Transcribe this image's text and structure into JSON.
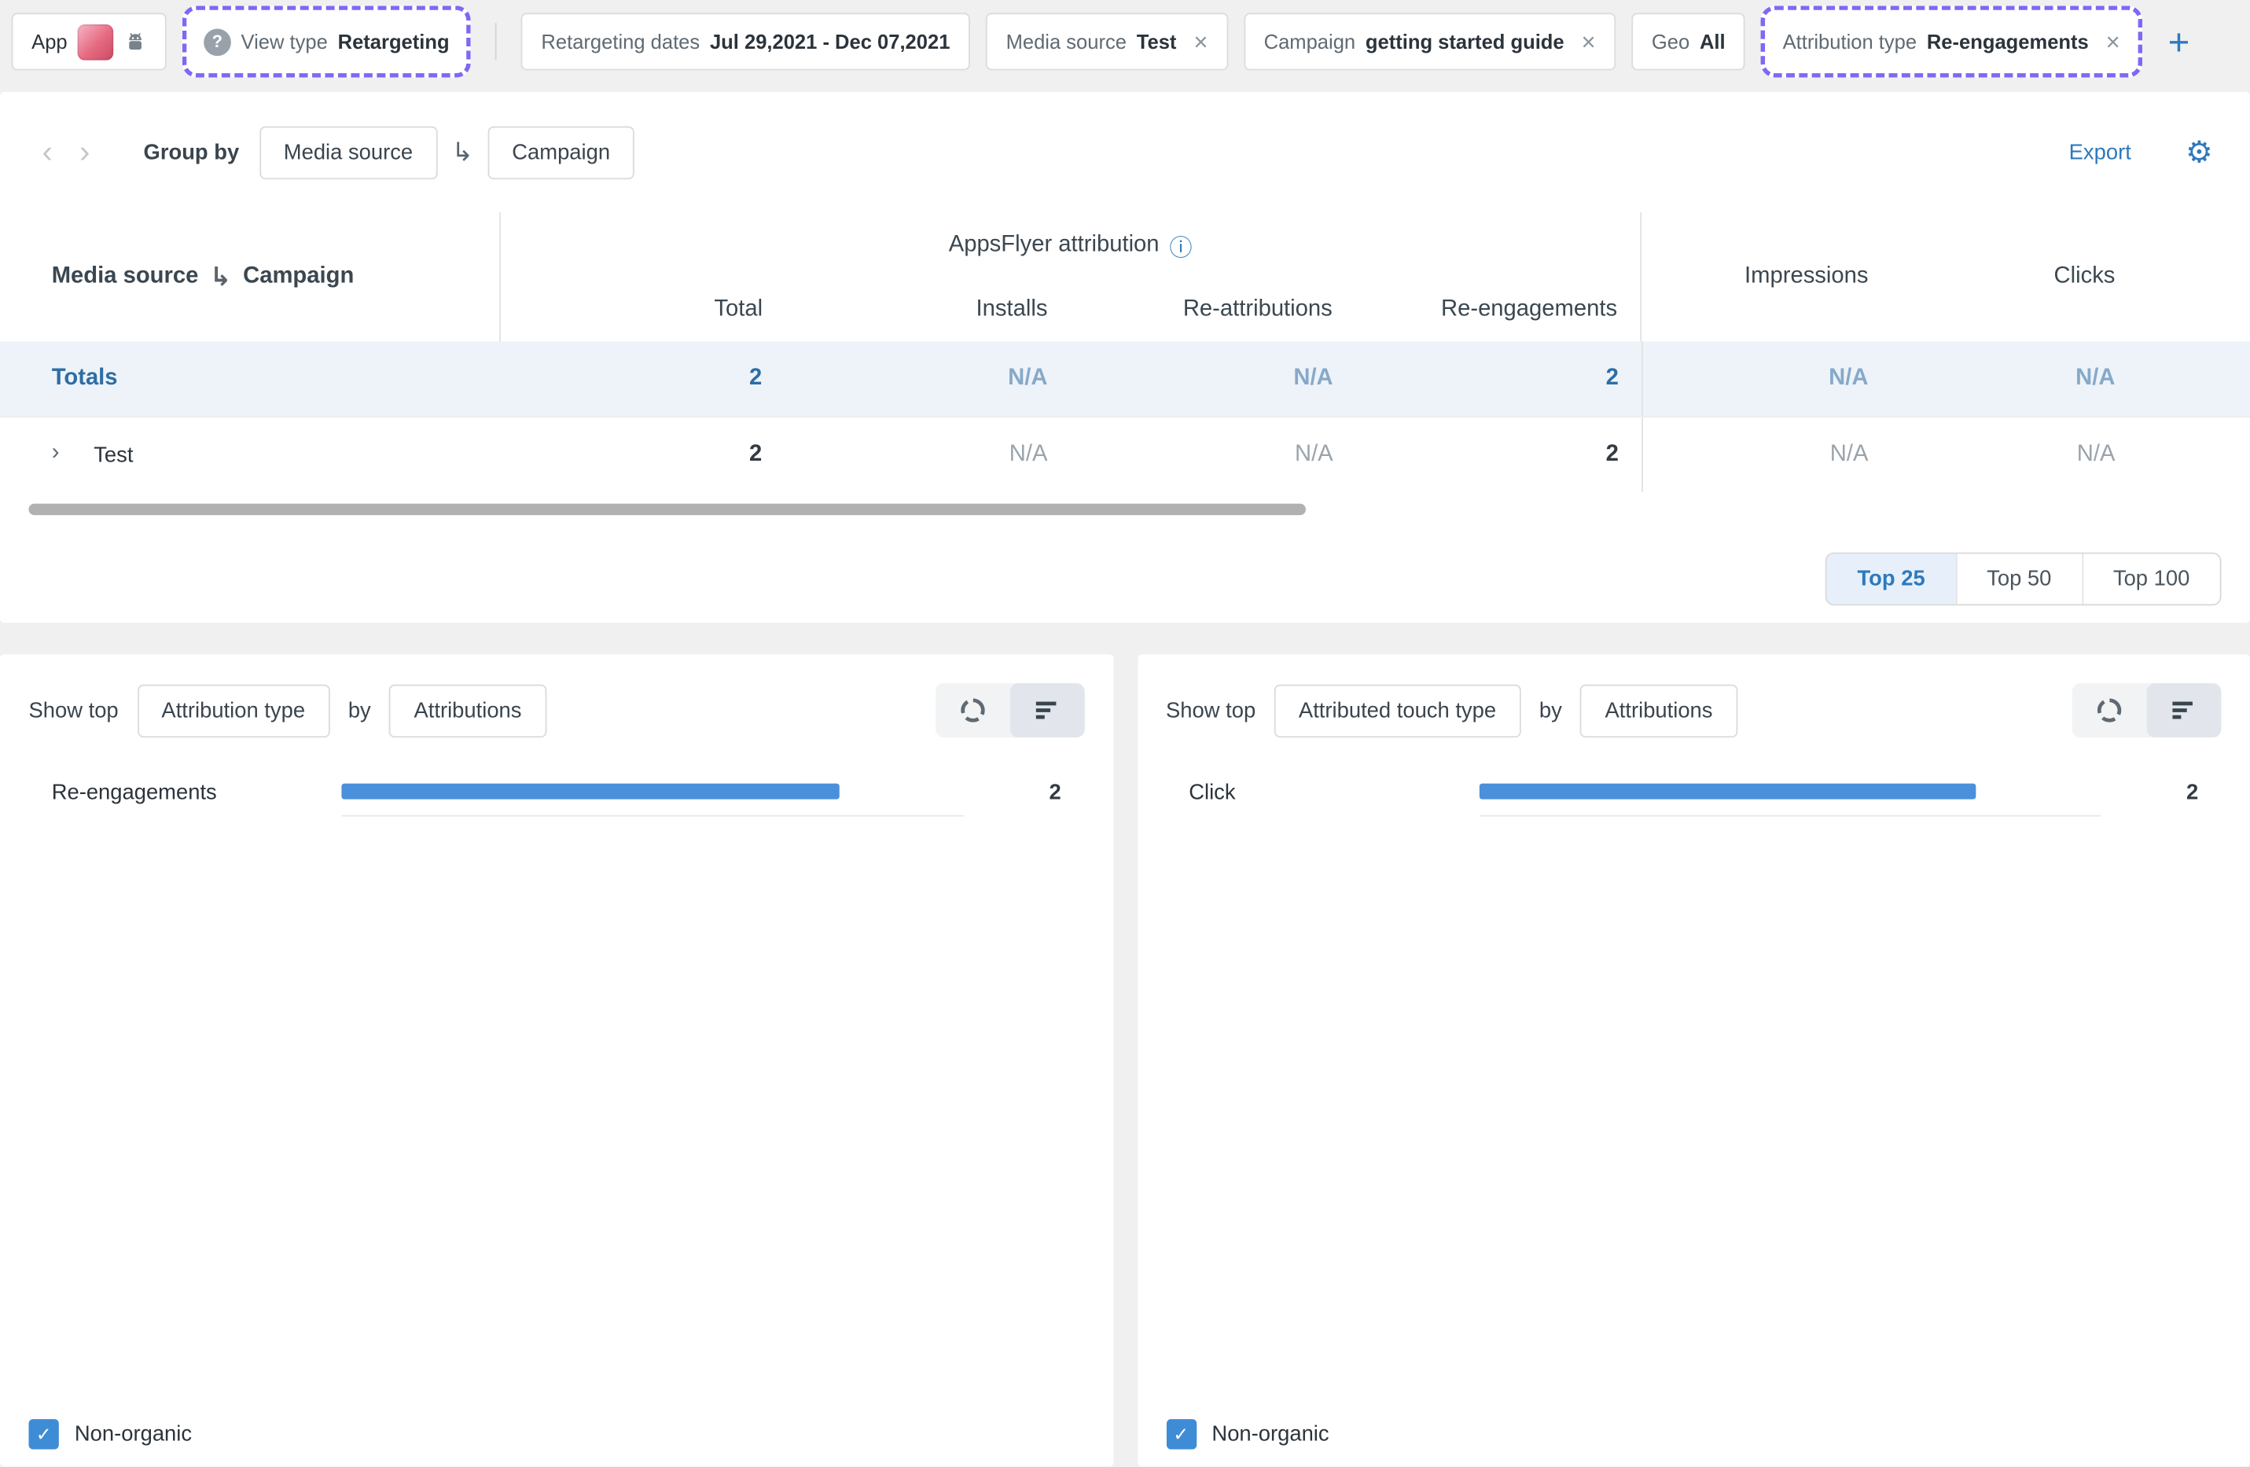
{
  "icons": {
    "question": "?",
    "close": "×",
    "plus": "+",
    "chevron_left": "‹",
    "chevron_right": "›",
    "nest_arrow": "↳",
    "info": "ⓘ",
    "gear": "⚙",
    "expand": "›",
    "check": "✓"
  },
  "colors": {
    "accent_blue": "#2e79bd",
    "bar_blue": "#4a90da",
    "highlight_purple": "#7e68f4",
    "totals_blue": "#2e6da4"
  },
  "filter_bar": {
    "app": {
      "label": "App"
    },
    "view_type": {
      "label": "View type",
      "value": "Retargeting"
    },
    "dates": {
      "label": "Retargeting dates",
      "value": "Jul 29,2021 - Dec 07,2021"
    },
    "media_source": {
      "label": "Media source",
      "value": "Test"
    },
    "campaign": {
      "label": "Campaign",
      "value": "getting started guide"
    },
    "geo": {
      "label": "Geo",
      "value": "All"
    },
    "attribution_type": {
      "label": "Attribution type",
      "value": "Re-engagements"
    }
  },
  "toolbar": {
    "group_by_label": "Group by",
    "group_primary": "Media source",
    "group_secondary": "Campaign",
    "export_label": "Export"
  },
  "table": {
    "row_header": {
      "primary": "Media source",
      "secondary": "Campaign"
    },
    "group_header": "AppsFlyer attribution",
    "columns": [
      "Total",
      "Installs",
      "Re-attributions",
      "Re-engagements"
    ],
    "right_columns": [
      "Impressions",
      "Clicks"
    ],
    "totals": {
      "label": "Totals",
      "values": [
        "2",
        "N/A",
        "N/A",
        "2",
        "N/A",
        "N/A"
      ]
    },
    "rows": [
      {
        "name": "Test",
        "values": [
          "2",
          "N/A",
          "N/A",
          "2",
          "N/A",
          "N/A"
        ]
      }
    ]
  },
  "top_toggle": {
    "options": [
      "Top 25",
      "Top 50",
      "Top 100"
    ],
    "selected": "Top 25"
  },
  "charts": [
    {
      "controls": {
        "show_top": "Show top",
        "dimension": "Attribution type",
        "by": "by",
        "metric": "Attributions"
      },
      "chart_data": {
        "type": "bar",
        "orientation": "horizontal",
        "categories": [
          "Re-engagements"
        ],
        "values": [
          2
        ],
        "xmax": 2.5,
        "bar_color": "#4a90da"
      },
      "legend": {
        "label": "Non-organic",
        "checked": true
      }
    },
    {
      "controls": {
        "show_top": "Show top",
        "dimension": "Attributed touch type",
        "by": "by",
        "metric": "Attributions"
      },
      "chart_data": {
        "type": "bar",
        "orientation": "horizontal",
        "categories": [
          "Click"
        ],
        "values": [
          2
        ],
        "xmax": 2.5,
        "bar_color": "#4a90da"
      },
      "legend": {
        "label": "Non-organic",
        "checked": true
      }
    }
  ]
}
